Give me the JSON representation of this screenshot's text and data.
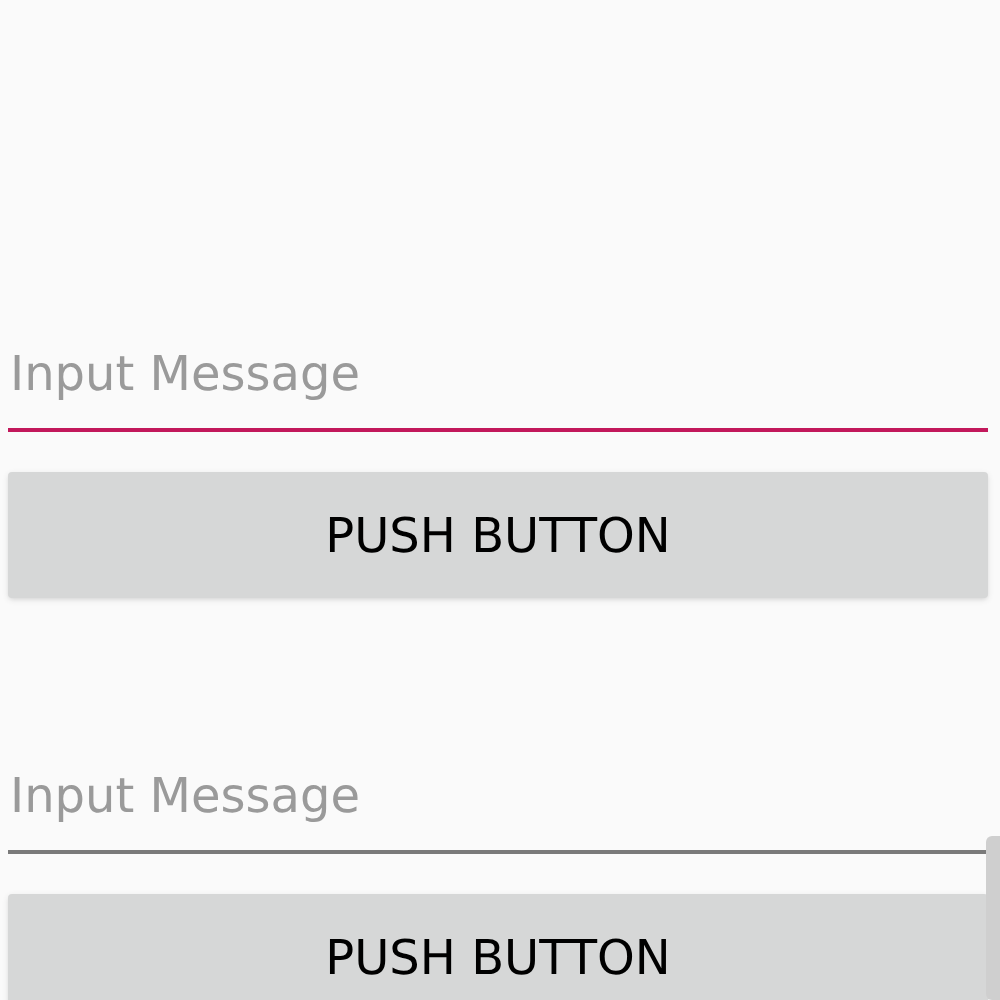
{
  "forms": [
    {
      "field": {
        "placeholder": "Input Message",
        "focused": true
      },
      "button": {
        "label": "PUSH BUTTON"
      }
    },
    {
      "field": {
        "placeholder": "Input Message",
        "focused": false
      },
      "button": {
        "label": "PUSH BUTTON"
      }
    }
  ]
}
